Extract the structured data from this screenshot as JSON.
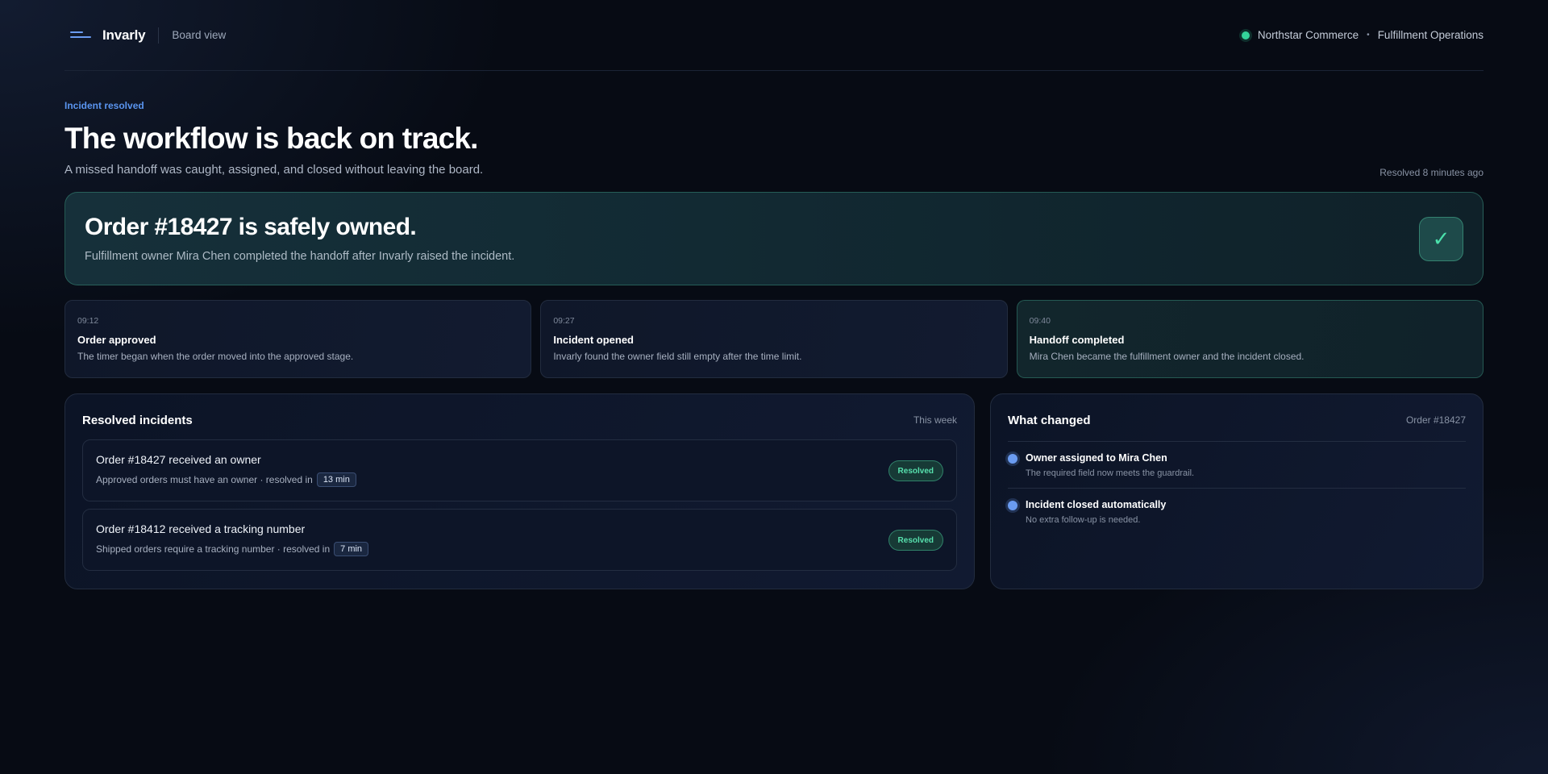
{
  "header": {
    "brand": "Invarly",
    "view": "Board view",
    "workspace": {
      "company": "Northstar Commerce",
      "separator": "•",
      "team": "Fulfillment Operations"
    }
  },
  "hero": {
    "eyebrow": "Incident resolved",
    "title": "The workflow is back on track.",
    "subtitle": "A missed handoff was caught, assigned, and closed without leaving the board.",
    "meta": "Resolved 8 minutes ago"
  },
  "banner": {
    "title": "Order #18427 is safely owned.",
    "subtitle": "Fulfillment owner Mira Chen completed the handoff after Invarly raised the incident.",
    "icon": "check-icon",
    "check_glyph": "✓"
  },
  "timeline": [
    {
      "time": "09:12",
      "title": "Order approved",
      "desc": "The timer began when the order moved into the approved stage."
    },
    {
      "time": "09:27",
      "title": "Incident opened",
      "desc": "Invarly found the owner field still empty after the time limit."
    },
    {
      "time": "09:40",
      "title": "Handoff completed",
      "desc": "Mira Chen became the fulfillment owner and the incident closed."
    }
  ],
  "resolved": {
    "title": "Resolved incidents",
    "meta": "This week",
    "items": [
      {
        "title": "Order #18427 received an owner",
        "desc": "Approved orders must have an owner · resolved in",
        "duration": "13 min",
        "status": "Resolved"
      },
      {
        "title": "Order #18412 received a tracking number",
        "desc": "Shipped orders require a tracking number · resolved in",
        "duration": "7 min",
        "status": "Resolved"
      }
    ]
  },
  "changes": {
    "title": "What changed",
    "meta": "Order #18427",
    "items": [
      {
        "title": "Owner assigned to Mira Chen",
        "desc": "The required field now meets the guardrail."
      },
      {
        "title": "Incident closed automatically",
        "desc": "No extra follow-up is needed."
      }
    ]
  },
  "colors": {
    "background": "#070b14",
    "accent_blue": "#5a95f0",
    "success_green": "#34d39a"
  }
}
